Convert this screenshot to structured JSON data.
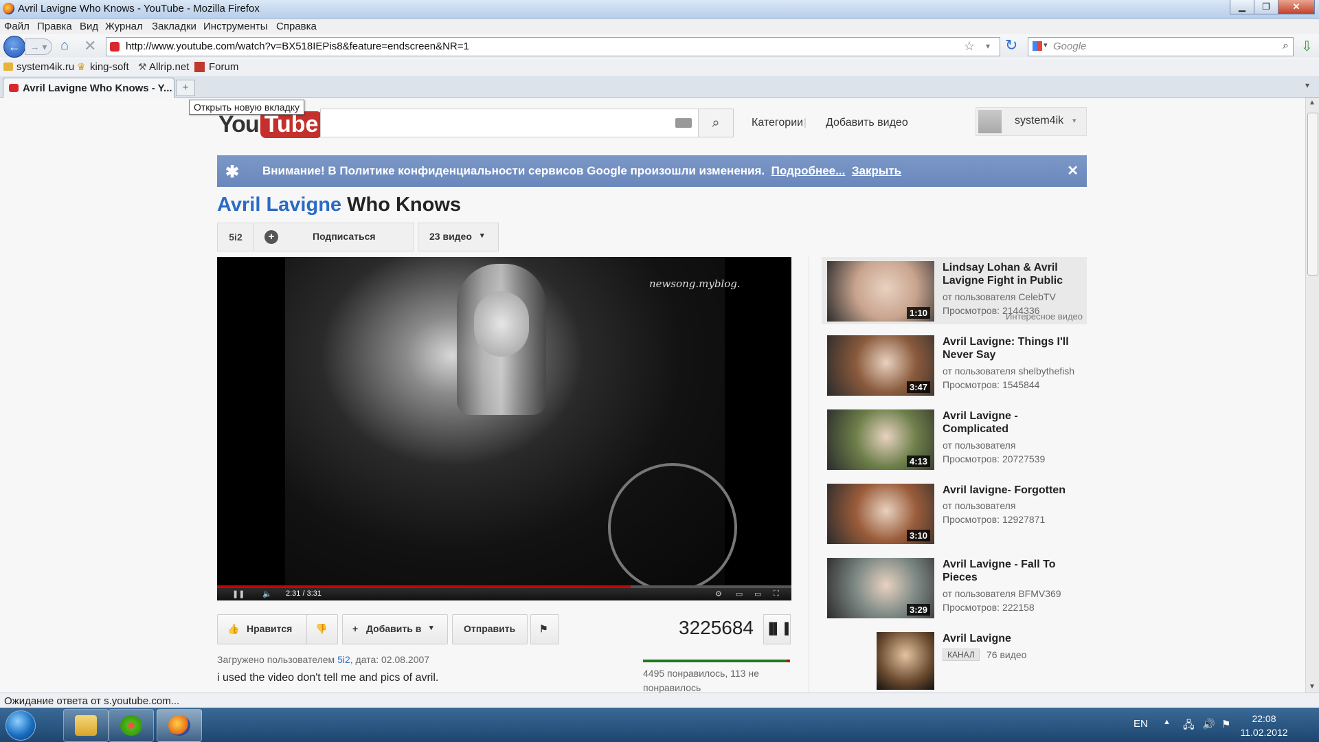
{
  "window": {
    "title": "Avril Lavigne Who Knows - YouTube - Mozilla Firefox"
  },
  "menu": [
    "Файл",
    "Правка",
    "Вид",
    "Журнал",
    "Закладки",
    "Инструменты",
    "Справка"
  ],
  "nav": {
    "url": "http://www.youtube.com/watch?v=BX518IEPis8&feature=endscreen&NR=1",
    "search_placeholder": "Google"
  },
  "bookmarks": [
    "system4ik.ru",
    "king-soft",
    "Allrip.net",
    "Forum"
  ],
  "tabs": [
    {
      "label": "Avril Lavigne Who Knows - Y..."
    }
  ],
  "tooltip": "Открыть новую вкладку",
  "youtube": {
    "logo_you": "You",
    "logo_tube": "Tube",
    "nav_categories": "Категории",
    "nav_upload": "Добавить видео",
    "username": "system4ik",
    "notice": {
      "text": "Внимание! В Политике конфиденциальности сервисов Google произошли изменения.",
      "more": "Подробнее...",
      "close": "Закрыть"
    },
    "video": {
      "channel": "Avril Lavigne",
      "title": "Who Knows",
      "channel_user": "5i2",
      "subscribe": "Подписаться",
      "videos_count": "23 видео",
      "watermark": "newsong.myblog.",
      "time": "2:31 / 3:31",
      "progress_fraction": 0.72,
      "like_label": "Нравится",
      "add_to_label": "Добавить в",
      "share_label": "Отправить",
      "views": "3225684",
      "uploaded_prefix": "Загружено пользователем",
      "uploader": "5i2",
      "uploaded_date": ", дата: 02.08.2007",
      "description": "i used the video don't tell me and pics of avril.",
      "likes_text": "4495 понравилось, 113 не понравилось",
      "like_fraction": 0.975
    },
    "related": [
      {
        "title": "Lindsay Lohan & Avril Lavigne Fight in Public",
        "by": "от пользователя CelebTV",
        "views": "Просмотров: 2144336",
        "duration": "1:10",
        "tag": "Интересное видео",
        "thumb_color": "#c9a48f"
      },
      {
        "title": "Avril Lavigne: Things I'll Never Say",
        "by": "от пользователя shelbythefish",
        "views": "Просмотров: 1545844",
        "duration": "3:47",
        "thumb_color": "#8a5a3c"
      },
      {
        "title": "Avril Lavigne - Complicated",
        "by": "от пользователя",
        "views": "Просмотров: 20727539",
        "duration": "4:13",
        "thumb_color": "#6d7f4a"
      },
      {
        "title": "Avril lavigne- Forgotten",
        "by": "от пользователя",
        "views": "Просмотров: 12927871",
        "duration": "3:10",
        "thumb_color": "#9a5c3a"
      },
      {
        "title": "Avril Lavigne - Fall To Pieces",
        "by": "от пользователя BFMV369",
        "views": "Просмотров: 222158",
        "duration": "3:29",
        "thumb_color": "#7f8a86"
      }
    ],
    "channel_card": {
      "title": "Avril Lavigne",
      "badge": "КАНАЛ",
      "videos": "76 видео"
    }
  },
  "status": "Ожидание ответа от s.youtube.com...",
  "taskbar": {
    "lang": "EN",
    "time": "22:08",
    "date": "11.02.2012"
  }
}
